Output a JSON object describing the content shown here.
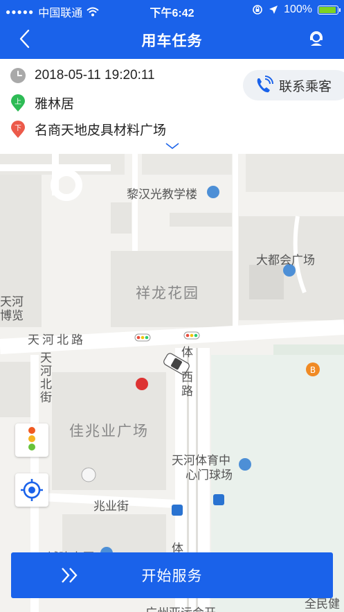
{
  "status_bar": {
    "carrier": "中国联通",
    "time": "下午6:42",
    "battery": "100%",
    "battery_level": 1.0,
    "icons": [
      "signal-dots-icon",
      "wifi-icon",
      "orientation-lock-icon",
      "location-arrow-icon",
      "battery-icon"
    ]
  },
  "nav": {
    "title": "用车任务",
    "back_icon": "back-chevron-icon",
    "service_icon": "customer-service-icon"
  },
  "trip": {
    "datetime": "2018-05-11 19:20:11",
    "pickup_badge": "上",
    "pickup": "雅林居",
    "dropoff_badge": "下",
    "dropoff": "名商天地皮具材料广场",
    "contact_label": "联系乘客",
    "colors": {
      "pickup": "#2dbb55",
      "dropoff": "#ec5a4a",
      "brand": "#1a62ea"
    }
  },
  "map": {
    "labels": {
      "school": "黎汉光教学楼",
      "plaza1": "大都会广场",
      "garden": "祥龙花园",
      "road_main": "天河北路",
      "road_left_v1": "天河",
      "road_left_v2": "北街",
      "road_left_v3": "",
      "road_tiyu_top": "体",
      "road_tiyu_west": "西路",
      "plaza2": "佳兆业广场",
      "stadium1": "天河体育中",
      "stadium2": "心门球场",
      "road_zhaoye": "兆业街",
      "road_tiyu_bottom": "体",
      "left_edge1": "天河",
      "left_edge2": "博览",
      "bottom_left": "城建大厦",
      "bottom_center": "广州亚运会开",
      "bottom_right": "全民健"
    }
  },
  "action": {
    "start_label": "开始服务"
  }
}
